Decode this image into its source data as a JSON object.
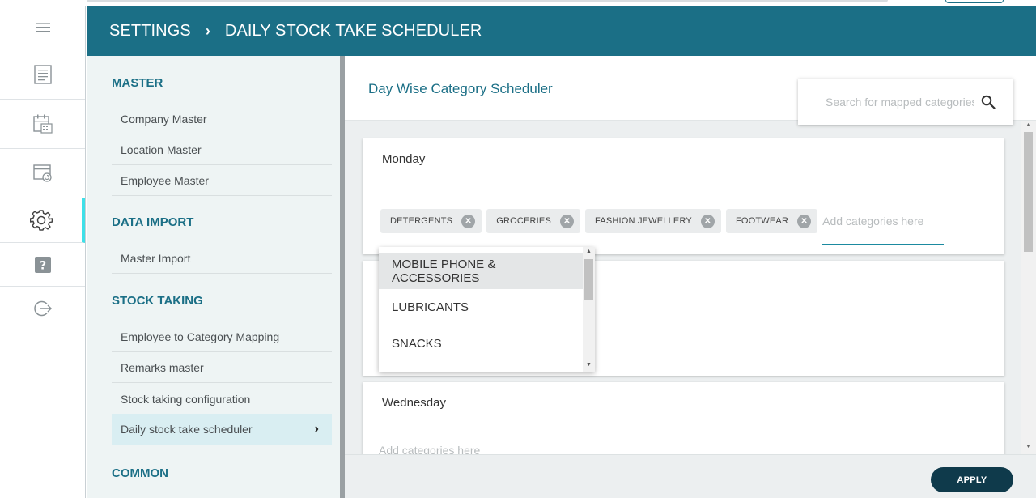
{
  "header": {
    "crumb_root": "SETTINGS",
    "crumb_separator": "›",
    "crumb_current": "DAILY STOCK TAKE SCHEDULER"
  },
  "rail": {
    "items": [
      {
        "icon": "menu-icon"
      },
      {
        "icon": "report-icon"
      },
      {
        "icon": "calendar-icon"
      },
      {
        "icon": "schedule-refresh-icon"
      },
      {
        "icon": "gear-icon",
        "active": true
      },
      {
        "icon": "help-icon"
      },
      {
        "icon": "logout-icon"
      }
    ]
  },
  "menu": {
    "sections": [
      {
        "title": "MASTER",
        "items": [
          "Company Master",
          "Location Master",
          "Employee Master"
        ]
      },
      {
        "title": "DATA IMPORT",
        "items": [
          "Master Import"
        ]
      },
      {
        "title": "STOCK TAKING",
        "items": [
          "Employee to Category Mapping",
          "Remarks master",
          "Stock taking configuration",
          "Daily stock take scheduler"
        ]
      },
      {
        "title": "COMMON",
        "items": []
      }
    ],
    "selected_chevron": "›"
  },
  "main": {
    "title": "Day Wise Category Scheduler",
    "search_placeholder": "Search for mapped categories",
    "days": [
      {
        "label": "Monday",
        "chips": [
          "DETERGENTS",
          "GROCERIES",
          "FASHION JEWELLERY",
          "FOOTWEAR"
        ],
        "input_placeholder": "Add categories here"
      },
      {
        "label": "",
        "chips": [],
        "input_placeholder": ""
      },
      {
        "label": "Wednesday",
        "chips": [],
        "input_placeholder": "Add categories here"
      }
    ],
    "dropdown_options": [
      "MOBILE PHONE & ACCESSORIES",
      "LUBRICANTS",
      "SNACKS"
    ],
    "apply_label": "APPLY"
  },
  "colors": {
    "brand": "#1b6f86",
    "menu_bg": "#eef4f4",
    "active_indicator": "#3fe0e8",
    "apply_bg": "#0f3a4b"
  }
}
